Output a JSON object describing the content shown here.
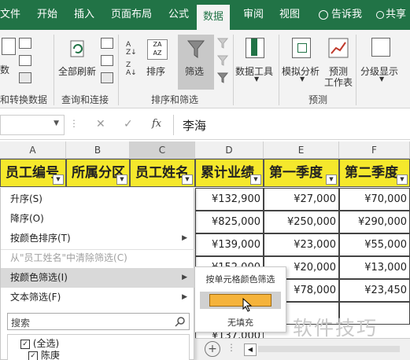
{
  "ribbon": {
    "tabs": [
      "文件",
      "开始",
      "插入",
      "页面布局",
      "公式",
      "数据",
      "审阅",
      "视图",
      "告诉我",
      "共享"
    ],
    "active_tab": "数据",
    "buttons": {
      "data_left": "数",
      "refresh_all": "全部刷新",
      "sort": "排序",
      "filter": "筛选",
      "data_tools": "数据工具",
      "what_if": "模拟分析",
      "forecast_line1": "预测",
      "forecast_line2": "工作表",
      "outline": "分级显示"
    },
    "groups": {
      "get_transform": "和转换数据",
      "queries": "查询和连接",
      "sort_filter": "排序和筛选",
      "forecast": "预测"
    }
  },
  "formula_bar": {
    "fx": "fx",
    "value": "李海"
  },
  "columns": [
    "A",
    "B",
    "C",
    "D",
    "E",
    "F"
  ],
  "header_row": [
    "员工编号",
    "所属分区",
    "员工姓名",
    "累计业绩",
    "第一季度",
    "第二季度"
  ],
  "rows": [
    {
      "d": "¥132,900",
      "e": "¥27,000",
      "f": "¥70,000"
    },
    {
      "d": "¥825,000",
      "e": "¥250,000",
      "f": "¥290,000"
    },
    {
      "d": "¥139,000",
      "e": "¥23,000",
      "f": "¥55,000"
    },
    {
      "d": "¥152,000",
      "e": "¥20,000",
      "f": "¥13,000"
    },
    {
      "d": "",
      "e": "¥78,000",
      "f": "¥23,450"
    },
    {
      "d": "",
      "e": "",
      "f": ""
    },
    {
      "d": "¥137,000",
      "e": "",
      "f": ""
    }
  ],
  "menu": {
    "sort_asc": "升序(S)",
    "sort_desc": "降序(O)",
    "sort_by_color": "按颜色排序(T)",
    "clear_filter": "从\"员工姓名\"中清除筛选(C)",
    "filter_by_color": "按颜色筛选(I)",
    "text_filter": "文本筛选(F)",
    "search_placeholder": "搜索",
    "items": [
      "(全选)",
      "陈庚"
    ]
  },
  "submenu": {
    "title": "按单元格颜色筛选",
    "no_fill": "无填充",
    "swatch_color": "#f5b33b"
  },
  "watermark": "软件技巧"
}
